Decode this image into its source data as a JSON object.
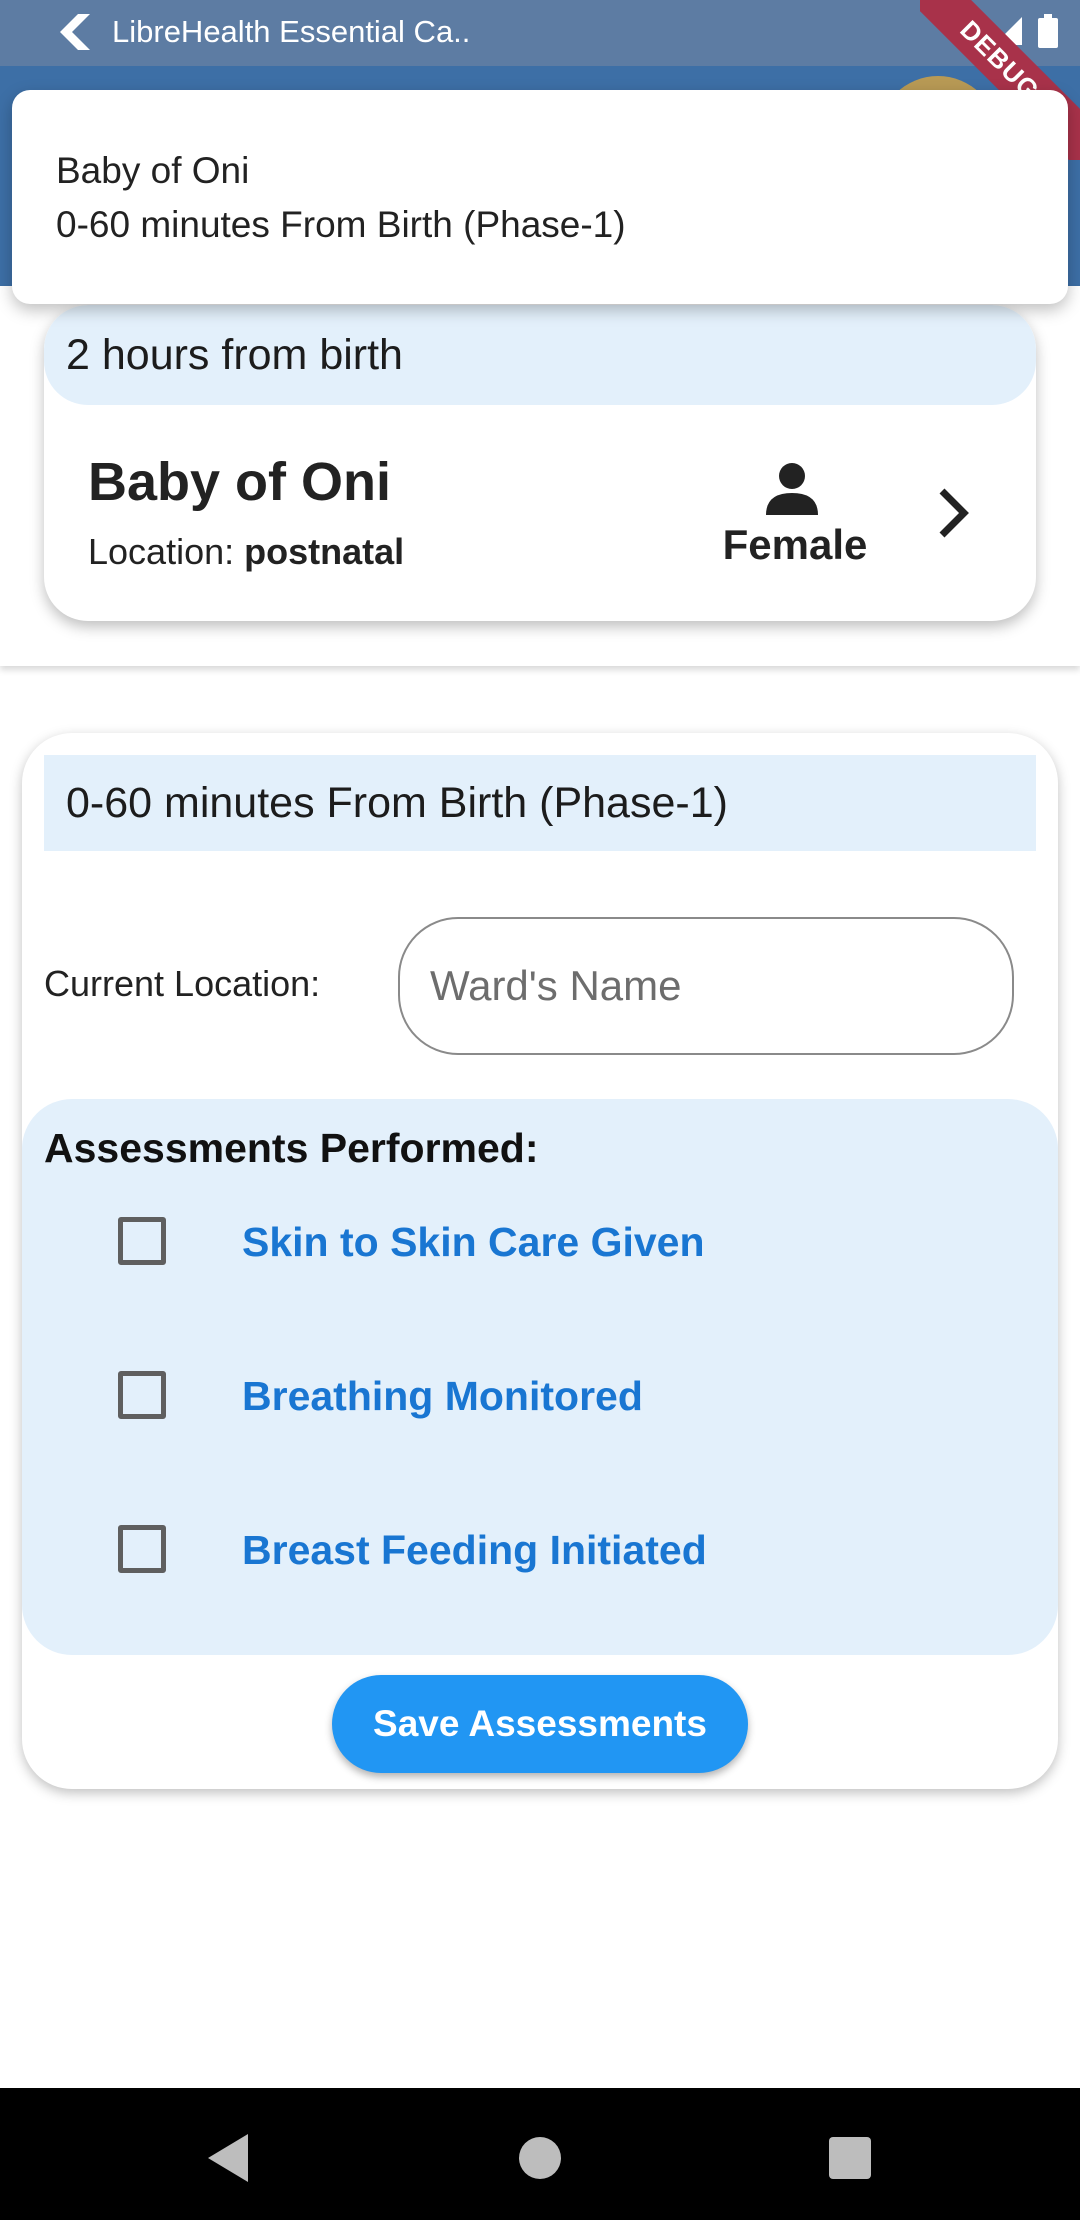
{
  "status_bar": {
    "task_title": "LibreHealth Essential Ca..",
    "debug_banner": "DEBUG"
  },
  "popup": {
    "line1": "Baby of Oni",
    "line2": "0-60 minutes From Birth (Phase-1)"
  },
  "baby_card": {
    "time_from_birth": "2 hours from birth",
    "name": "Baby of Oni",
    "location_label": "Location: ",
    "location_value": "postnatal",
    "gender": "Female"
  },
  "assessment_card": {
    "phase_title": "0-60 minutes From Birth (Phase-1)",
    "current_location_label": "Current Location:",
    "ward_input": {
      "placeholder": "Ward's Name",
      "value": ""
    },
    "assessments_title": "Assessments Performed:",
    "assessments": [
      {
        "label": "Skin to Skin Care Given",
        "checked": false
      },
      {
        "label": "Breathing Monitored",
        "checked": false
      },
      {
        "label": "Breast Feeding Initiated",
        "checked": false
      }
    ],
    "save_label": "Save Assessments"
  },
  "colors": {
    "accent_blue": "#2196f3",
    "link_blue": "#1976d2",
    "light_blue_bg": "#e3f0fb",
    "debug_red": "#a8324a"
  },
  "icons": {
    "back": "flutter-back-icon",
    "wifi": "wifi-icon",
    "signal": "signal-icon",
    "battery": "battery-icon",
    "person": "person-icon",
    "chevron": "chevron-right-icon",
    "nav_back": "nav-back-icon",
    "nav_home": "nav-home-icon",
    "nav_recents": "nav-recents-icon"
  }
}
